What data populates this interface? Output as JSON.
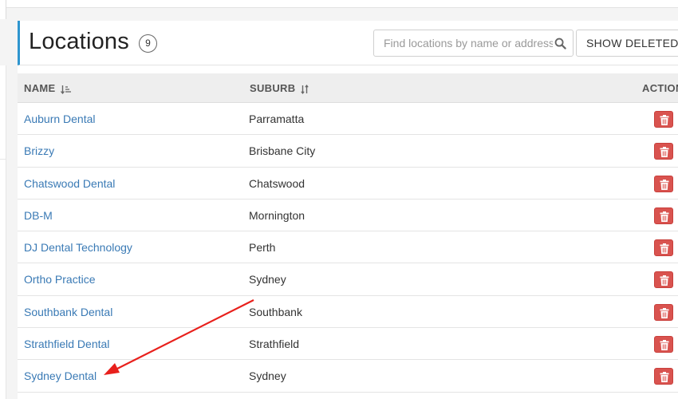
{
  "header": {
    "title": "Locations",
    "count": "9"
  },
  "search": {
    "placeholder": "Find locations by name or address",
    "value": "",
    "icon": "search-icon"
  },
  "toolbar": {
    "show_deleted_label": "SHOW DELETED"
  },
  "table": {
    "columns": {
      "name": "NAME",
      "suburb": "SUBURB",
      "action": "ACTION"
    },
    "rows": [
      {
        "name": "Auburn Dental",
        "suburb": "Parramatta"
      },
      {
        "name": "Brizzy",
        "suburb": "Brisbane City"
      },
      {
        "name": "Chatswood Dental",
        "suburb": "Chatswood"
      },
      {
        "name": "DB-M",
        "suburb": "Mornington"
      },
      {
        "name": "DJ Dental Technology",
        "suburb": "Perth"
      },
      {
        "name": "Ortho Practice",
        "suburb": "Sydney"
      },
      {
        "name": "Southbank Dental",
        "suburb": "Southbank"
      },
      {
        "name": "Strathfield Dental",
        "suburb": "Strathfield"
      },
      {
        "name": "Sydney Dental",
        "suburb": "Sydney"
      }
    ]
  },
  "colors": {
    "accent": "#2e95cf",
    "link": "#3a7ab5",
    "danger": "#d9534f",
    "annotation_arrow": "#e8201c"
  }
}
